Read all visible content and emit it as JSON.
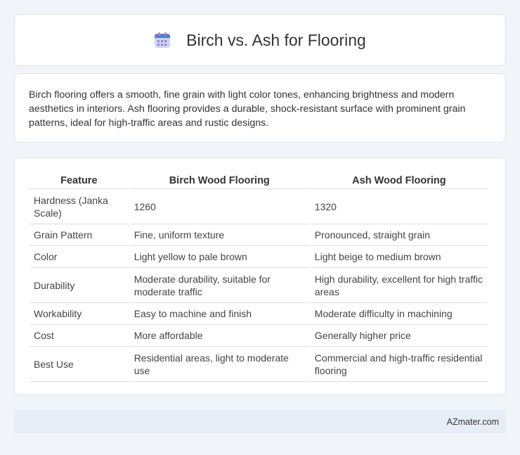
{
  "header": {
    "icon": "calendar-icon",
    "title": "Birch vs. Ash for Flooring"
  },
  "description": "Birch flooring offers a smooth, fine grain with light color tones, enhancing brightness and modern aesthetics in interiors. Ash flooring provides a durable, shock-resistant surface with prominent grain patterns, ideal for high-traffic areas and rustic designs.",
  "table": {
    "headers": [
      "Feature",
      "Birch Wood Flooring",
      "Ash Wood Flooring"
    ],
    "rows": [
      [
        "Hardness (Janka Scale)",
        "1260",
        "1320"
      ],
      [
        "Grain Pattern",
        "Fine, uniform texture",
        "Pronounced, straight grain"
      ],
      [
        "Color",
        "Light yellow to pale brown",
        "Light beige to medium brown"
      ],
      [
        "Durability",
        "Moderate durability, suitable for moderate traffic",
        "High durability, excellent for high traffic areas"
      ],
      [
        "Workability",
        "Easy to machine and finish",
        "Moderate difficulty in machining"
      ],
      [
        "Cost",
        "More affordable",
        "Generally higher price"
      ],
      [
        "Best Use",
        "Residential areas, light to moderate use",
        "Commercial and high-traffic residential flooring"
      ]
    ]
  },
  "footer": {
    "text": "AZmater.com"
  },
  "colors": {
    "background": "#f1f4f9",
    "card": "#ffffff",
    "footer": "#e6edf7"
  }
}
